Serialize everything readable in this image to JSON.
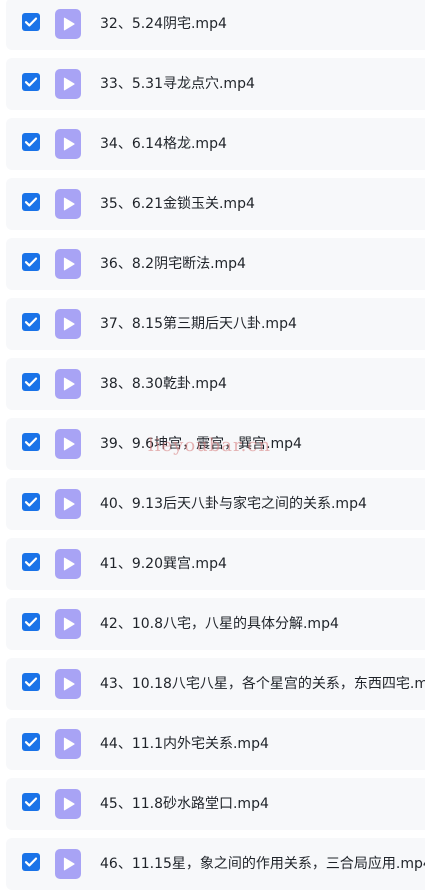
{
  "files": [
    {
      "name": "32、5.24阴宅.mp4",
      "checked": true
    },
    {
      "name": "33、5.31寻龙点穴.mp4",
      "checked": true
    },
    {
      "name": "34、6.14格龙.mp4",
      "checked": true
    },
    {
      "name": "35、6.21金锁玉关.mp4",
      "checked": true
    },
    {
      "name": "36、8.2阴宅断法.mp4",
      "checked": true
    },
    {
      "name": "37、8.15第三期后天八卦.mp4",
      "checked": true
    },
    {
      "name": "38、8.30乾卦.mp4",
      "checked": true
    },
    {
      "name": "39、9.6坤宫，震宫，巽宫.mp4",
      "checked": true
    },
    {
      "name": "40、9.13后天八卦与家宅之间的关系.mp4",
      "checked": true
    },
    {
      "name": "41、9.20巽宫.mp4",
      "checked": true
    },
    {
      "name": "42、10.8八宅，八星的具体分解.mp4",
      "checked": true
    },
    {
      "name": "43、10.18八宅八星，各个星宫的关系，东西四宅.mp4",
      "checked": true
    },
    {
      "name": "44、11.1内外宅关系.mp4",
      "checked": true
    },
    {
      "name": "45、11.8砂水路堂口.mp4",
      "checked": true
    },
    {
      "name": "46、11.15星，象之间的作用关系，三合局应用.mp4",
      "checked": true
    }
  ],
  "watermark": "lieyoubar.cn",
  "colors": {
    "checkbox": "#1a73e8",
    "file_icon": "#a8a3f5",
    "row_bg": "#f7f8fa"
  },
  "icons": {
    "checkbox": "checkmark-icon",
    "file": "video-file-icon"
  }
}
